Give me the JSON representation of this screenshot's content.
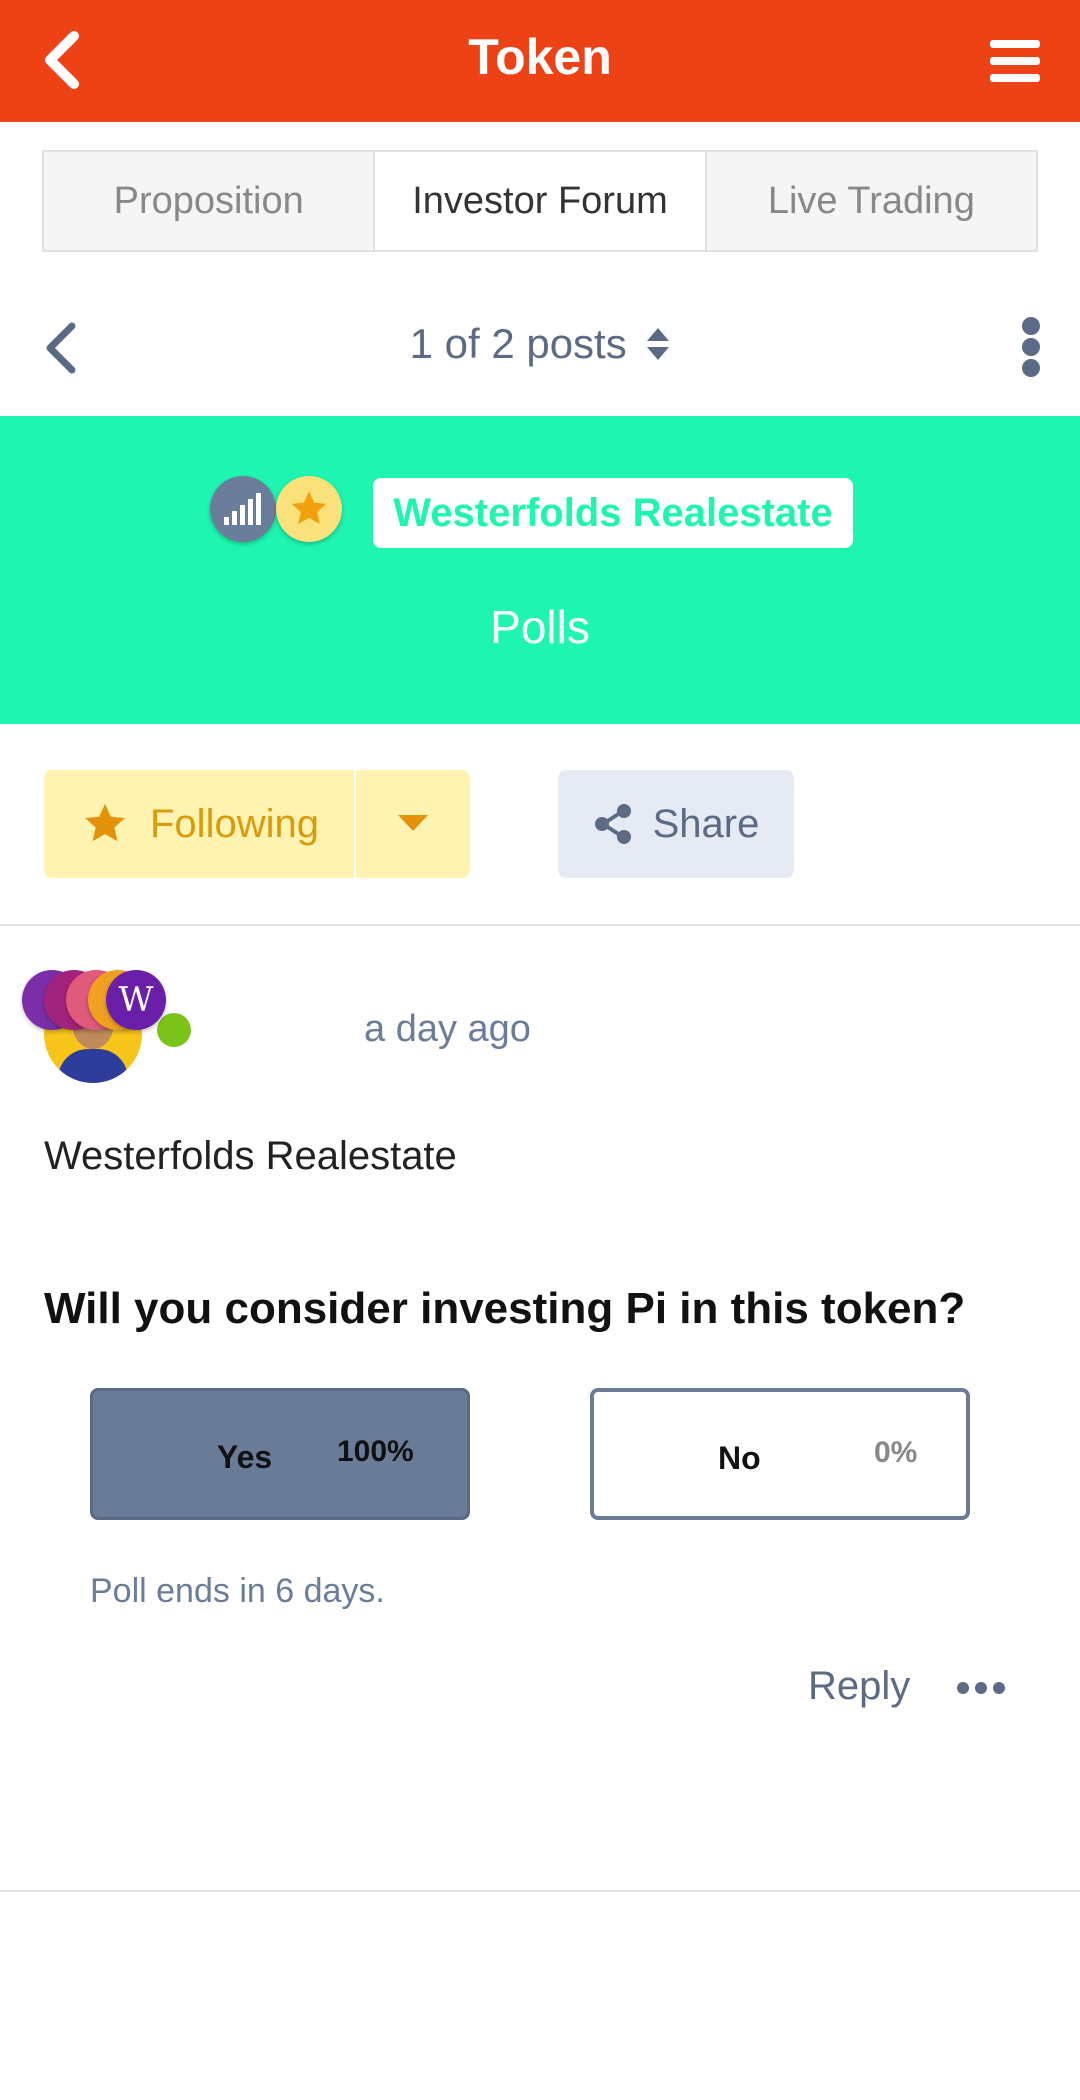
{
  "header": {
    "title": "Token",
    "back_icon": "chevron-left-icon",
    "menu_icon": "hamburger-menu-icon",
    "color": "#ec4216"
  },
  "tabs": [
    {
      "label": "Proposition",
      "active": false
    },
    {
      "label": "Investor Forum",
      "active": true
    },
    {
      "label": "Live Trading",
      "active": false
    }
  ],
  "post_nav": {
    "counter": "1 of 2 posts",
    "prev_icon": "chevron-left-icon",
    "sort_icon": "sort-icon",
    "more_icon": "more-vertical-icon"
  },
  "banner": {
    "name": "Westerfolds Realestate",
    "subtitle": "Polls",
    "color": "#1ef5b0",
    "badges": [
      "signal-bars-icon",
      "star-icon"
    ]
  },
  "actions": {
    "following_label": "Following",
    "share_label": "Share"
  },
  "post": {
    "timestamp": "a day ago",
    "author_name": "Westerfolds Realestate",
    "question": "Will you consider investing Pi in this token?",
    "badge_initial": "W",
    "options": [
      {
        "label": "Yes",
        "percent": "100%",
        "selected": true
      },
      {
        "label": "No",
        "percent": "0%",
        "selected": false
      }
    ],
    "poll_status": "Poll ends in 6 days.",
    "reply_label": "Reply"
  }
}
